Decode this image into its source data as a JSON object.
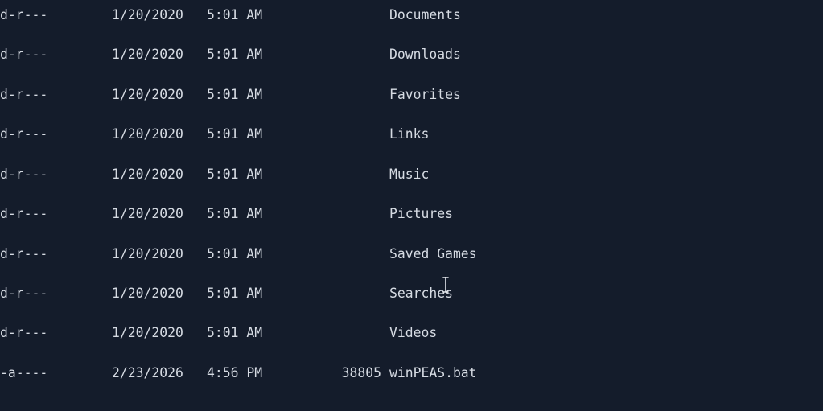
{
  "rows": [
    {
      "mode": "d-r---",
      "date": "1/20/2020",
      "time": "5:01 AM",
      "length": "",
      "name": "Documents"
    },
    {
      "mode": "d-r---",
      "date": "1/20/2020",
      "time": "5:01 AM",
      "length": "",
      "name": "Downloads"
    },
    {
      "mode": "d-r---",
      "date": "1/20/2020",
      "time": "5:01 AM",
      "length": "",
      "name": "Favorites"
    },
    {
      "mode": "d-r---",
      "date": "1/20/2020",
      "time": "5:01 AM",
      "length": "",
      "name": "Links"
    },
    {
      "mode": "d-r---",
      "date": "1/20/2020",
      "time": "5:01 AM",
      "length": "",
      "name": "Music"
    },
    {
      "mode": "d-r---",
      "date": "1/20/2020",
      "time": "5:01 AM",
      "length": "",
      "name": "Pictures"
    },
    {
      "mode": "d-r---",
      "date": "1/20/2020",
      "time": "5:01 AM",
      "length": "",
      "name": "Saved Games"
    },
    {
      "mode": "d-r---",
      "date": "1/20/2020",
      "time": "5:01 AM",
      "length": "",
      "name": "Searches"
    },
    {
      "mode": "d-r---",
      "date": "1/20/2020",
      "time": "5:01 AM",
      "length": "",
      "name": "Videos"
    },
    {
      "mode": "-a----",
      "date": "2/23/2026",
      "time": "4:56 PM",
      "length": "38805",
      "name": "winPEAS.bat"
    }
  ],
  "colors": {
    "background": "#141c2b",
    "foreground": "#d6dbe3"
  },
  "cursor_icon": "text-cursor-icon"
}
